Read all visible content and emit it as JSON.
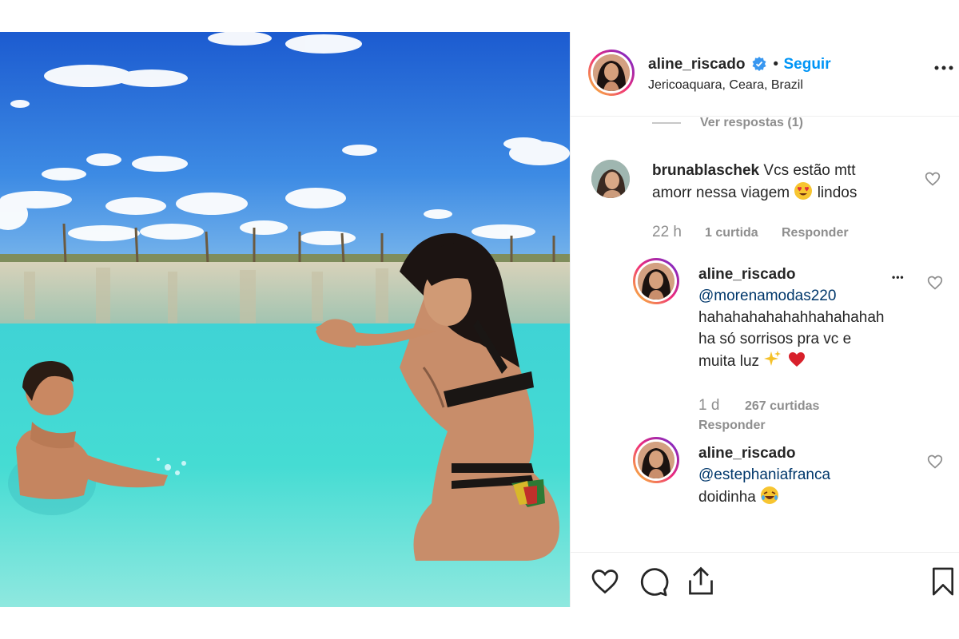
{
  "post": {
    "username": "aline_riscado",
    "follow_label": "Seguir",
    "separator": "•",
    "location": "Jericoaquara, Ceara, Brazil",
    "more_label": "..."
  },
  "replies_toggle": "Ver respostas (1)",
  "comments": [
    {
      "username": "brunablaschek",
      "text_line1": "Vcs estão mtt",
      "text_line2_a": "amorr nessa viagem",
      "text_line2_b": "lindos",
      "time": "22 h",
      "likes": "1 curtida",
      "reply_label": "Responder"
    },
    {
      "username": "aline_riscado",
      "mention": "@morenamodas220",
      "text_line1": "hahahahahahahhahahahah",
      "text_line2": "ha só sorrisos pra vc e",
      "text_line3": "muita luz",
      "time": "1 d",
      "likes": "267 curtidas",
      "reply_label": "Responder",
      "more_label": "•••"
    },
    {
      "username": "aline_riscado",
      "mention": "@estephaniafranca",
      "text_line1": "doidinha"
    }
  ],
  "colors": {
    "link": "#00376b",
    "follow": "#0095f6",
    "verified": "#3897f0",
    "muted": "#8e8e8e"
  },
  "icons": [
    "verified-badge-icon",
    "more-options-icon",
    "heart-icon",
    "comment-icon",
    "share-icon",
    "bookmark-icon"
  ]
}
